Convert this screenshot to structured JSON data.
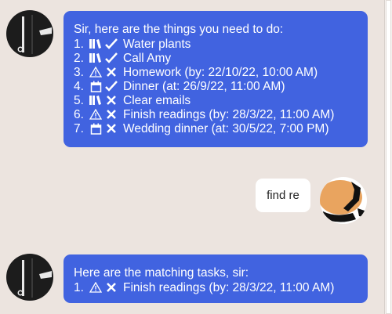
{
  "messages": {
    "bot_1": {
      "header": "Sir, here are the things you need to do:",
      "tasks": [
        {
          "num": "1.",
          "category_icon": "books-icon",
          "status_icon": "check-icon",
          "text": "Water plants"
        },
        {
          "num": "2.",
          "category_icon": "books-icon",
          "status_icon": "check-icon",
          "text": "Call Amy"
        },
        {
          "num": "3.",
          "category_icon": "warning-icon",
          "status_icon": "cross-icon",
          "text": "Homework (by: 22/10/22, 10:00 AM)"
        },
        {
          "num": "4.",
          "category_icon": "calendar-icon",
          "status_icon": "check-icon",
          "text": "Dinner (at: 26/9/22, 11:00 AM)"
        },
        {
          "num": "5.",
          "category_icon": "books-icon",
          "status_icon": "cross-icon",
          "text": "Clear emails"
        },
        {
          "num": "6.",
          "category_icon": "warning-icon",
          "status_icon": "cross-icon",
          "text": "Finish readings (by: 28/3/22, 11:00 AM)"
        },
        {
          "num": "7.",
          "category_icon": "calendar-icon",
          "status_icon": "cross-icon",
          "text": "Wedding dinner (at: 30/5/22, 7:00 PM)"
        }
      ]
    },
    "user_1": {
      "text": "find re"
    },
    "bot_2": {
      "header": "Here are the matching tasks, sir:",
      "tasks": [
        {
          "num": "1.",
          "category_icon": "warning-icon",
          "status_icon": "cross-icon",
          "text": "Finish readings (by: 28/3/22, 11:00 AM)"
        }
      ]
    }
  },
  "colors": {
    "chat_background": "#ece4df",
    "bot_bubble": "#4163e0",
    "user_bubble": "#ffffff",
    "bot_avatar": "#1c1c1c",
    "user_avatar_skin": "#e9a45f"
  }
}
